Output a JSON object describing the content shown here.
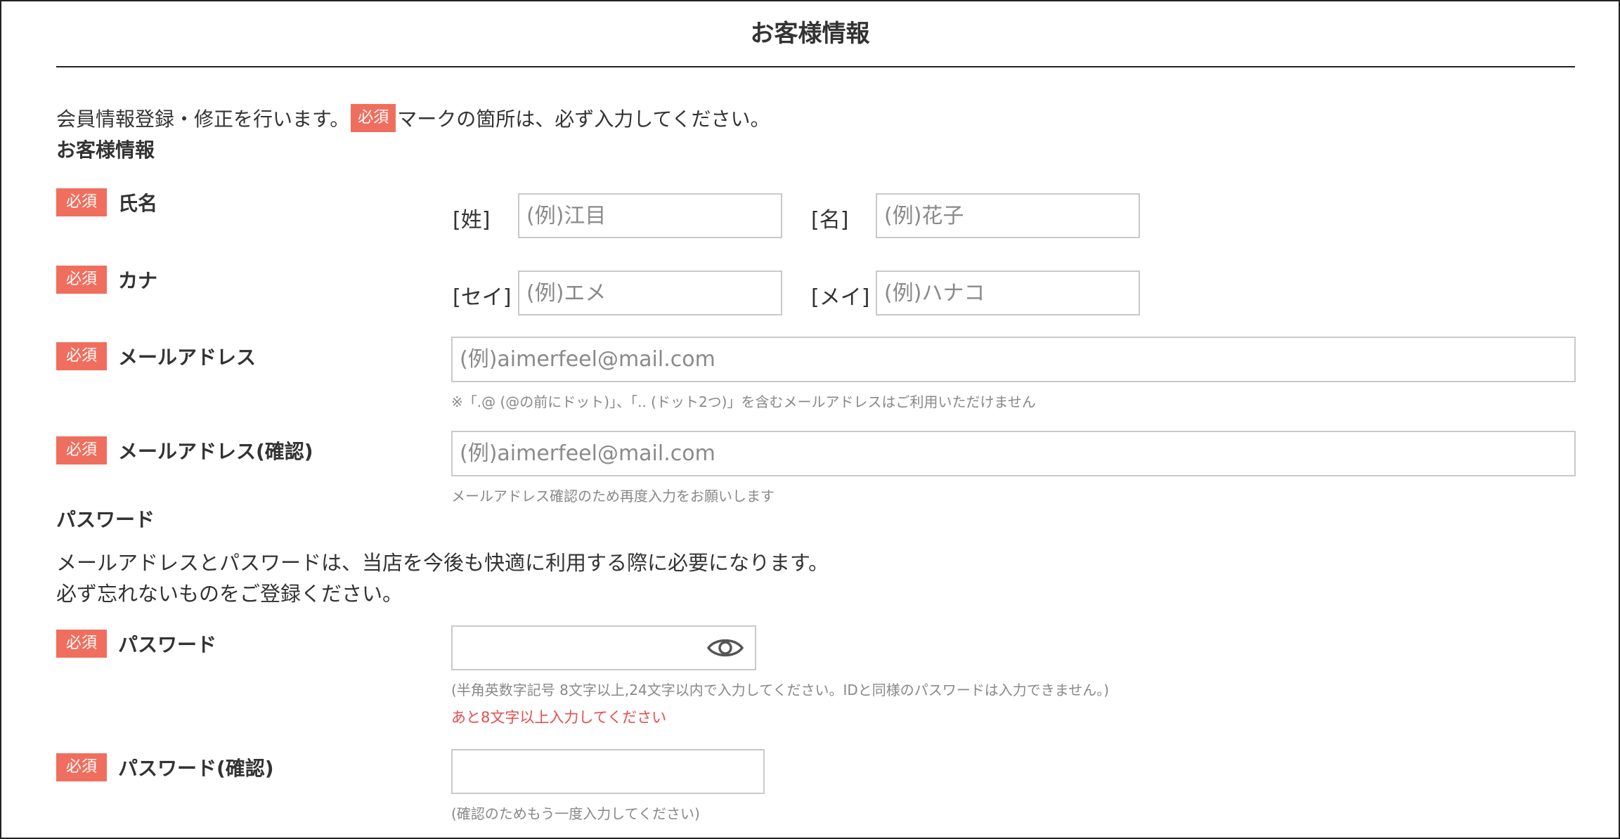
{
  "page_title": "お客様情報",
  "intro": {
    "before": "会員情報登録・修正を行います。",
    "badge": "必須",
    "after": "マークの箇所は、必ず入力してください。"
  },
  "section_customer": "お客様情報",
  "required_badge": "必須",
  "name": {
    "label": "氏名",
    "last_prefix": "[姓]",
    "last_placeholder": "(例)江目",
    "first_prefix": "[名]",
    "first_placeholder": "(例)花子"
  },
  "kana": {
    "label": "カナ",
    "last_prefix": "[セイ]",
    "last_placeholder": "(例)エメ",
    "first_prefix": "[メイ]",
    "first_placeholder": "(例)ハナコ"
  },
  "email": {
    "label": "メールアドレス",
    "placeholder": "(例)aimerfeel@mail.com",
    "note": "※「.@ (@の前にドット)」、「.. (ドット2つ)」を含むメールアドレスはご利用いただけません"
  },
  "email_confirm": {
    "label": "メールアドレス(確認)",
    "placeholder": "(例)aimerfeel@mail.com",
    "note": "メールアドレス確認のため再度入力をお願いします"
  },
  "section_password": "パスワード",
  "password_intro": {
    "line1": "メールアドレスとパスワードは、当店を今後も快適に利用する際に必要になります。",
    "line2": "必ず忘れないものをご登録ください。"
  },
  "password": {
    "label": "パスワード",
    "value": "",
    "icon": "eye-icon",
    "note": "(半角英数字記号 8文字以上,24文字以内で入力してください。IDと同様のパスワードは入力できません。)",
    "error": "あと8文字以上入力してください"
  },
  "password_confirm": {
    "label": "パスワード(確認)",
    "value": "",
    "note": "(確認のためもう一度入力してください)"
  },
  "colors": {
    "badge": "#f06e5e",
    "error": "#e84c4c",
    "border": "#c9c9c9"
  }
}
